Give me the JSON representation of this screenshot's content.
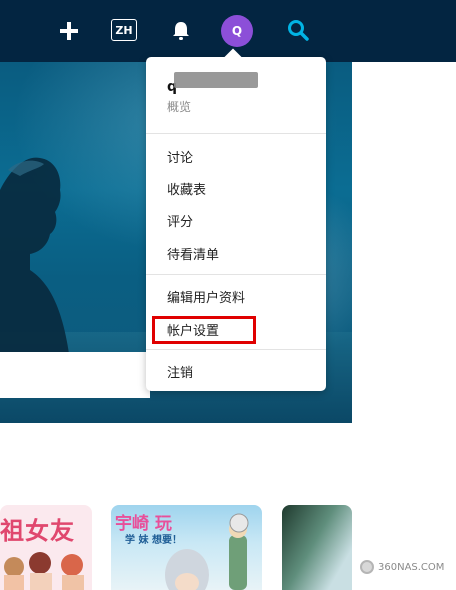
{
  "topbar": {
    "language_code": "ZH",
    "avatar_initial": "Q",
    "icons": [
      "plus-icon",
      "bell-icon",
      "search-icon"
    ],
    "background_color": "#032541",
    "avatar_color": "#8c4fd8",
    "search_color": "#01b4e4"
  },
  "account_menu": {
    "username_visible_prefix": "q",
    "overview_label": "概览",
    "group1": [
      "讨论",
      "收藏表",
      "评分",
      "待看清单"
    ],
    "group2": [
      "编辑用户资料",
      "帐户设置"
    ],
    "group3": [
      "注销"
    ],
    "highlight_color": "#e00000"
  },
  "posters": {
    "poster1_title": "祖女友",
    "poster2_title": "宇崎 玩",
    "poster2_subtitle": "学 妹 想要！"
  },
  "watermark": {
    "text": "360NAS.COM"
  }
}
